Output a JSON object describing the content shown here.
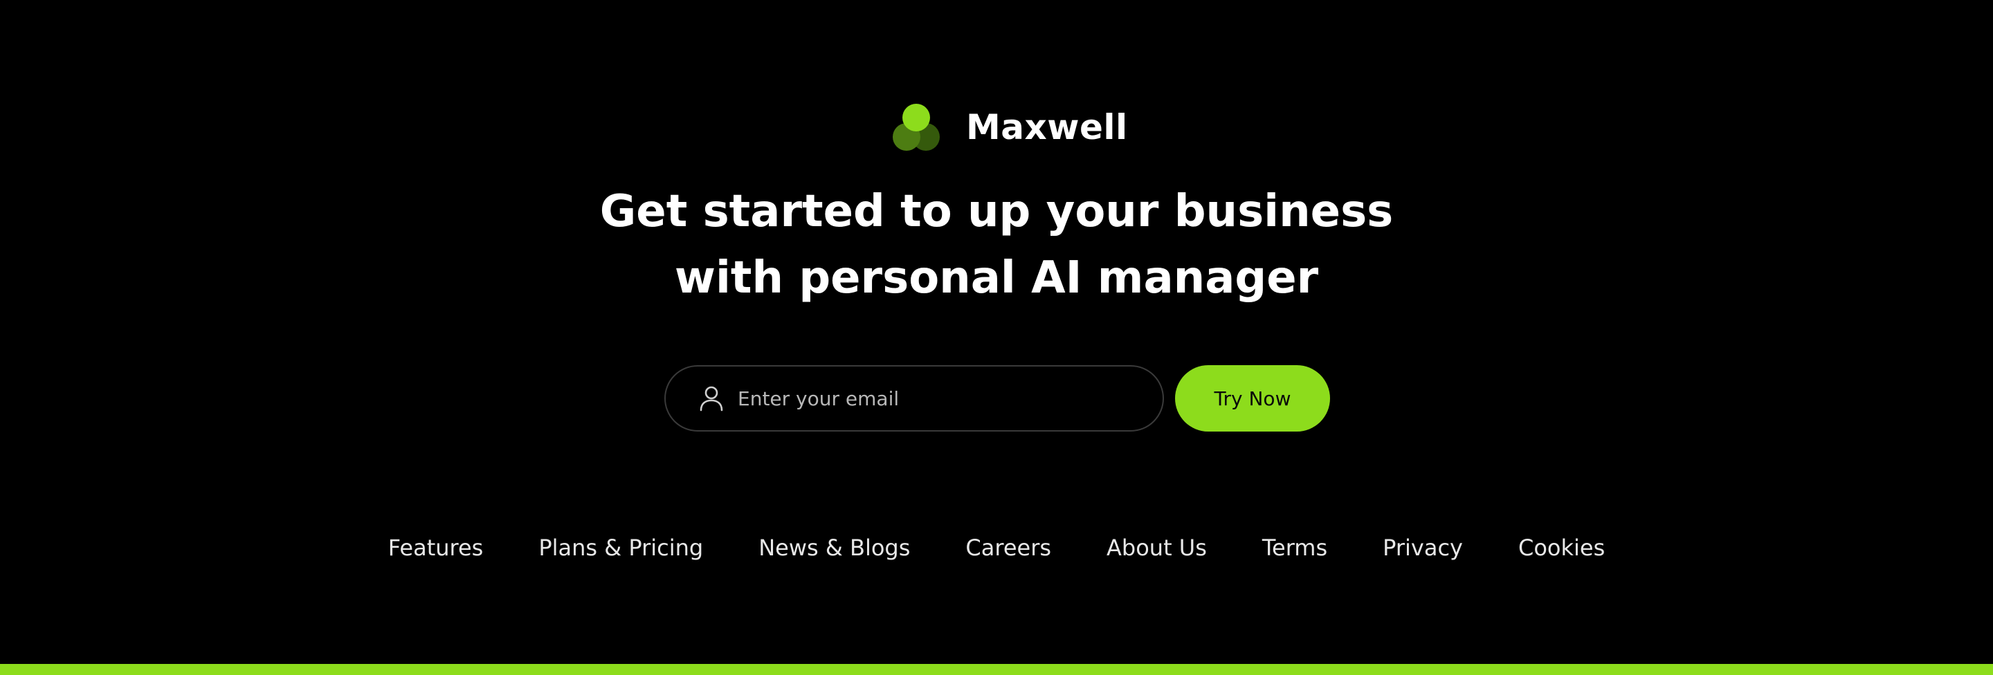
{
  "brand": {
    "name": "Maxwell",
    "logo_icon": "three-circles-logo-icon"
  },
  "hero": {
    "line1": "Get started to up your business",
    "line2": "with personal AI manager"
  },
  "signup": {
    "email_placeholder": "Enter your email",
    "email_value": "",
    "user_icon": "user-icon",
    "button_label": "Try Now"
  },
  "footer": {
    "links": [
      "Features",
      "Plans & Pricing",
      "News & Blogs",
      "Careers",
      "About Us",
      "Terms",
      "Privacy",
      "Cookies"
    ]
  },
  "colors": {
    "background": "#000000",
    "accent": "#8ddc1c",
    "accent_dark": "#4d7d12",
    "accent_darker": "#355a0c",
    "text": "#ffffff",
    "field_border": "#3a3a3a"
  }
}
